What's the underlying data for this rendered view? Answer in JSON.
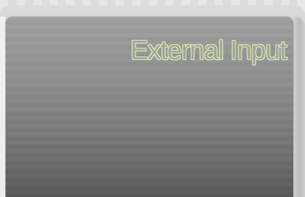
{
  "screen": {
    "title": "External Input"
  },
  "colors": {
    "panel_top": "#a0a0a0",
    "panel_bottom": "#565656",
    "title_outline": "#d8f5a8",
    "title_fill": "#a3a3a3"
  }
}
